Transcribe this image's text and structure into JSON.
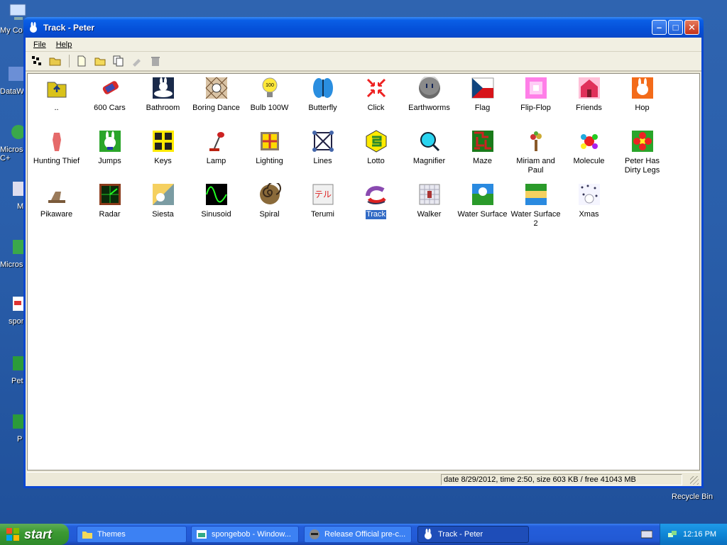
{
  "desktop": {
    "icons": [
      {
        "name": "my-computer",
        "label": "My Co"
      },
      {
        "name": "dataw",
        "label": "DataW"
      },
      {
        "name": "microsoft-c",
        "label": "Microso C+"
      },
      {
        "name": "m",
        "label": "M"
      },
      {
        "name": "microsoft-basic",
        "label": "Micros Bas"
      },
      {
        "name": "sponge",
        "label": "spon"
      },
      {
        "name": "peter",
        "label": "Pet"
      },
      {
        "name": "p",
        "label": "P"
      }
    ],
    "recycle_bin": "Recycle Bin"
  },
  "window": {
    "title": "Track - Peter",
    "menu": {
      "file": "File",
      "help": "Help"
    },
    "toolbar": [
      "grid-icon",
      "open-folder-icon",
      "new-file-icon",
      "folder-icon",
      "copy-icon",
      "text-tool-icon",
      "trash-icon"
    ],
    "items": [
      {
        "label": "..",
        "icon": "up-folder"
      },
      {
        "label": "600 Cars",
        "icon": "car"
      },
      {
        "label": "Bathroom",
        "icon": "bathroom"
      },
      {
        "label": "Boring Dance",
        "icon": "boring-dance"
      },
      {
        "label": "Bulb 100W",
        "icon": "bulb"
      },
      {
        "label": "Butterfly",
        "icon": "butterfly"
      },
      {
        "label": "Click",
        "icon": "click"
      },
      {
        "label": "Earthworms",
        "icon": "earthworms"
      },
      {
        "label": "Flag",
        "icon": "flag"
      },
      {
        "label": "Flip-Flop",
        "icon": "flip-flop"
      },
      {
        "label": "Friends",
        "icon": "friends"
      },
      {
        "label": "Hop",
        "icon": "hop"
      },
      {
        "label": "Hunting Thief",
        "icon": "hunting-thief"
      },
      {
        "label": "Jumps",
        "icon": "jumps"
      },
      {
        "label": "Keys",
        "icon": "keys"
      },
      {
        "label": "Lamp",
        "icon": "lamp"
      },
      {
        "label": "Lighting",
        "icon": "lighting"
      },
      {
        "label": "Lines",
        "icon": "lines"
      },
      {
        "label": "Lotto",
        "icon": "lotto"
      },
      {
        "label": "Magnifier",
        "icon": "magnifier"
      },
      {
        "label": "Maze",
        "icon": "maze"
      },
      {
        "label": "Miriam and Paul",
        "icon": "miriam-and-paul"
      },
      {
        "label": "Molecule",
        "icon": "molecule"
      },
      {
        "label": "Peter Has Dirty Legs",
        "icon": "peter-dirty-legs"
      },
      {
        "label": "Pikaware",
        "icon": "pikaware"
      },
      {
        "label": "Radar",
        "icon": "radar"
      },
      {
        "label": "Siesta",
        "icon": "siesta"
      },
      {
        "label": "Sinusoid",
        "icon": "sinusoid"
      },
      {
        "label": "Spiral",
        "icon": "spiral"
      },
      {
        "label": "Terumi",
        "icon": "terumi"
      },
      {
        "label": "Track",
        "icon": "track",
        "selected": true
      },
      {
        "label": "Walker",
        "icon": "walker"
      },
      {
        "label": "Water Surface",
        "icon": "water-surface"
      },
      {
        "label": "Water Surface 2",
        "icon": "water-surface-2"
      },
      {
        "label": "Xmas",
        "icon": "xmas"
      }
    ],
    "status": "date 8/29/2012, time 2:50, size 603 KB / free 41043 MB"
  },
  "taskbar": {
    "start": "start",
    "tasks": [
      {
        "label": "Themes",
        "icon": "folder-icon"
      },
      {
        "label": "spongebob - Window...",
        "icon": "image-icon"
      },
      {
        "label": "Release Official pre-c...",
        "icon": "raccoon-icon"
      },
      {
        "label": "Track - Peter",
        "icon": "rabbit-icon",
        "active": true
      }
    ],
    "clock": "12:16 PM"
  },
  "colors": {
    "selection": "#316ac5",
    "titlebar": "#0550d8",
    "taskbar": "#245edb",
    "start": "#3c9a33"
  }
}
